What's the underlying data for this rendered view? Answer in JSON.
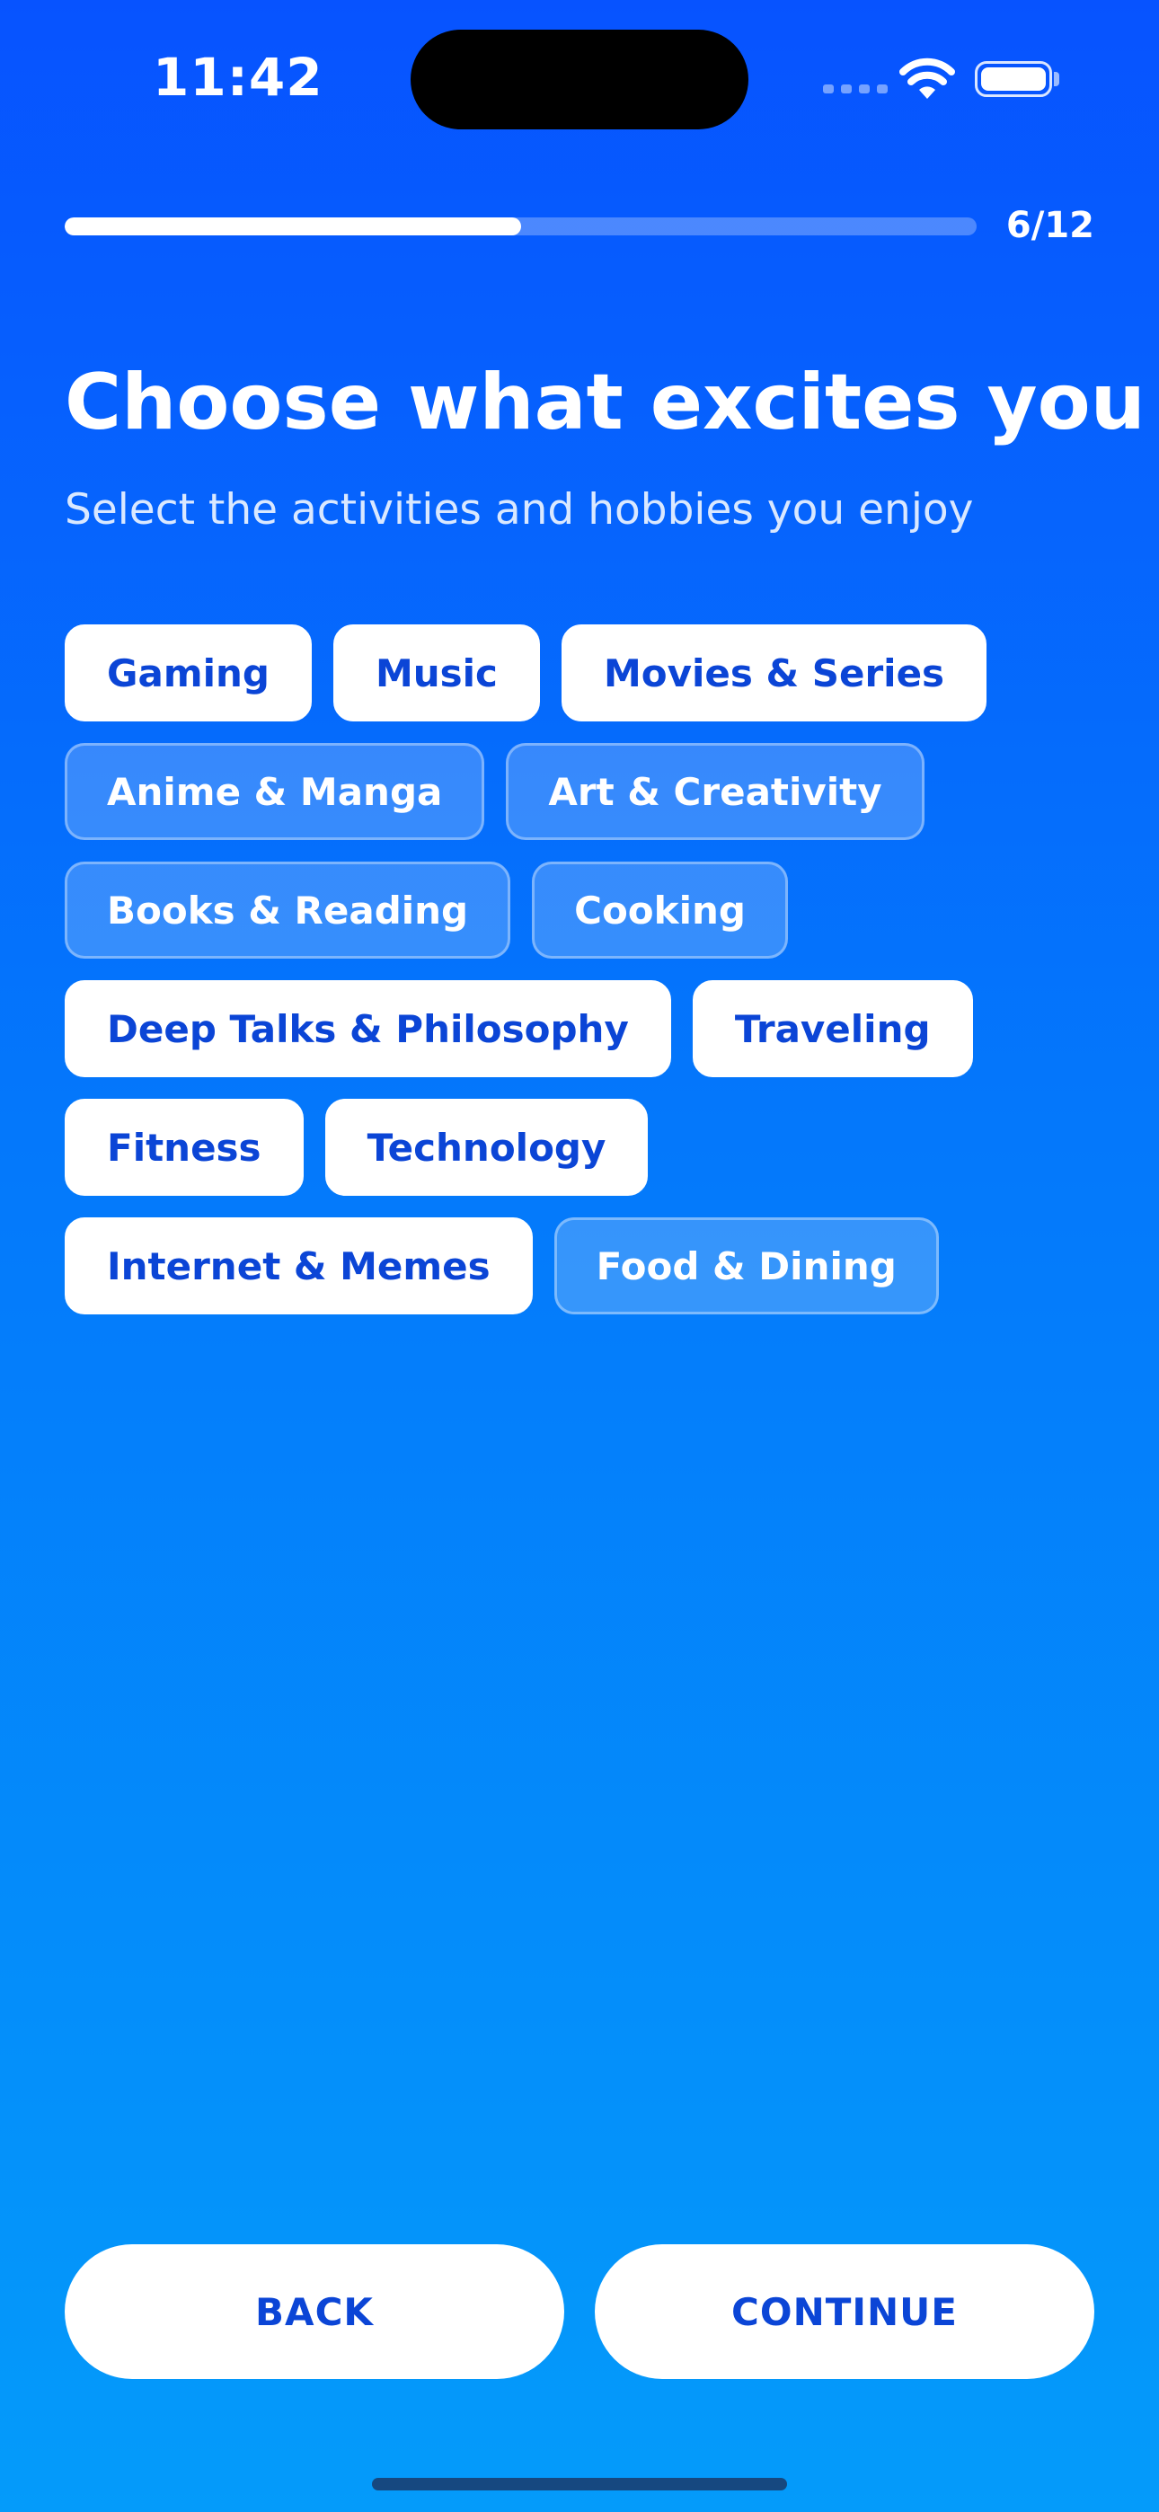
{
  "status_bar": {
    "time": "11:42",
    "icons": [
      "signal-icon",
      "wifi-icon",
      "battery-icon"
    ]
  },
  "progress": {
    "label": "6/12",
    "fraction": 0.5
  },
  "header": {
    "title": "Choose what excites you",
    "subtitle": "Select the activities and hobbies you enjoy"
  },
  "interests": [
    {
      "label": "Gaming",
      "selected": true
    },
    {
      "label": "Music",
      "selected": true
    },
    {
      "label": "Movies & Series",
      "selected": true
    },
    {
      "label": "Anime & Manga",
      "selected": false
    },
    {
      "label": "Art & Creativity",
      "selected": false
    },
    {
      "label": "Books & Reading",
      "selected": false
    },
    {
      "label": "Cooking",
      "selected": false
    },
    {
      "label": "Deep Talks & Philosophy",
      "selected": true
    },
    {
      "label": "Traveling",
      "selected": true
    },
    {
      "label": "Fitness",
      "selected": true
    },
    {
      "label": "Technology",
      "selected": true
    },
    {
      "label": "Internet & Memes",
      "selected": true
    },
    {
      "label": "Food & Dining",
      "selected": false
    }
  ],
  "actions": {
    "back_label": "BACK",
    "continue_label": "CONTINUE"
  },
  "colors": {
    "background_top": "#0753ff",
    "background_bottom": "#049bfa",
    "accent_text": "#0b45d6"
  }
}
